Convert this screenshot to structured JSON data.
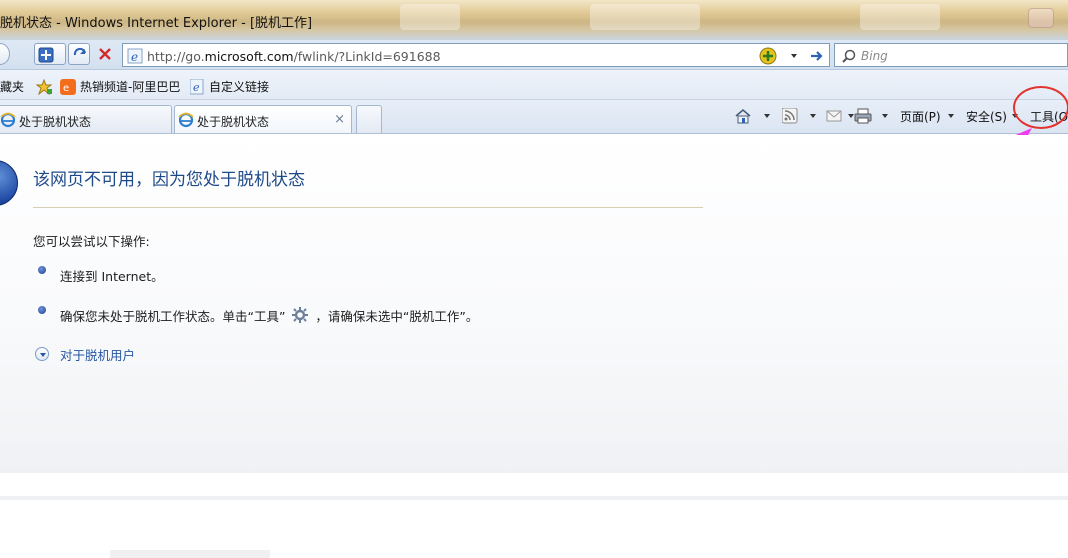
{
  "window": {
    "title": "脱机状态 - Windows Internet Explorer - [脱机工作]"
  },
  "address_bar": {
    "url_prefix": "http://go.",
    "url_domain": "microsoft.com",
    "url_suffix": "/fwlink/?LinkId=691688"
  },
  "search": {
    "placeholder": "Bing"
  },
  "favorites_bar": {
    "folder_label": "藏夹",
    "items": [
      {
        "label": "热销频道-阿里巴巴"
      },
      {
        "label": "自定义链接"
      }
    ]
  },
  "tabs": [
    {
      "label": "处于脱机状态"
    },
    {
      "label": "处于脱机状态",
      "close": "×"
    }
  ],
  "command_bar": {
    "page": "页面(P)",
    "safety": "安全(S)",
    "tools": "工具(O"
  },
  "content": {
    "heading": "该网页不可用，因为您处于脱机状态",
    "intro": "您可以尝试以下操作:",
    "bullets": [
      "连接到 Internet。",
      "确保您未处于脱机工作状态。单击“工具”",
      "，请确保未选中“脱机工作”。"
    ],
    "more_link": "对于脱机用户"
  },
  "colors": {
    "heading": "#1f4a8a",
    "link": "#2556a3",
    "highlight_circle": "#e2342f",
    "annotation_arrow": "#ee3cee"
  }
}
